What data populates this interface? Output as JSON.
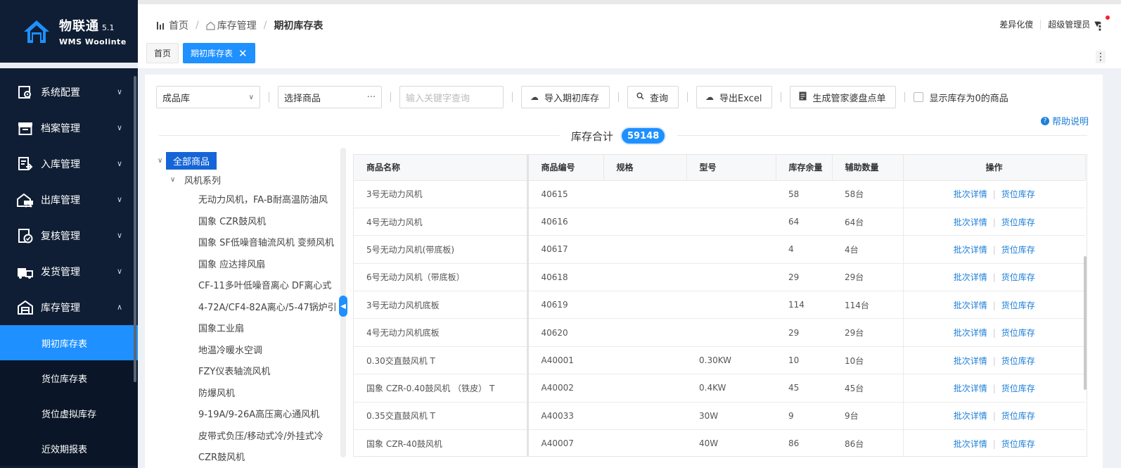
{
  "app": {
    "name": "物联通",
    "version": "5.1",
    "subtitle": "WMS Woolinte"
  },
  "sidebar": {
    "items": [
      {
        "label": "系统配置",
        "icon": "settings-box-icon",
        "arrow": "∨"
      },
      {
        "label": "档案管理",
        "icon": "archive-icon",
        "arrow": "∨"
      },
      {
        "label": "入库管理",
        "icon": "inbound-icon",
        "arrow": "∨"
      },
      {
        "label": "出库管理",
        "icon": "outbound-truck-icon",
        "arrow": "∨"
      },
      {
        "label": "复核管理",
        "icon": "review-check-icon",
        "arrow": "∨"
      },
      {
        "label": "发货管理",
        "icon": "shipping-icon",
        "arrow": "∨"
      },
      {
        "label": "库存管理",
        "icon": "warehouse-icon",
        "arrow": "∧"
      }
    ],
    "subitems": [
      {
        "label": "期初库存表",
        "active": true
      },
      {
        "label": "货位库存表",
        "active": false
      },
      {
        "label": "货位虚拟库存",
        "active": false
      },
      {
        "label": "近效期报表",
        "active": false
      }
    ]
  },
  "header": {
    "breadcrumb": [
      "首页",
      "库存管理",
      "期初库存表"
    ],
    "breadcrumb_sep": "/",
    "diff": "差异化傻",
    "user": "超级管理员",
    "tabs": [
      {
        "label": "首页",
        "active": false
      },
      {
        "label": "期初库存表",
        "active": true
      }
    ]
  },
  "toolbar": {
    "warehouse_value": "成品库",
    "product_select": "选择商品",
    "product_select_more": "···",
    "keyword_placeholder": "输入关键字查询",
    "import_label": "导入期初库存",
    "query_label": "查询",
    "export_label": "导出Excel",
    "generate_label": "生成管家婆盘点单",
    "show_zero_label": "显示库存为0的商品",
    "help_label": "帮助说明"
  },
  "summary": {
    "label": "库存合计",
    "total": "59148"
  },
  "tree": {
    "root": "全部商品",
    "group": "风机系列",
    "leaves": [
      "无动力风机，FA-B耐高温防油风",
      "国象 CZR鼓风机",
      "国象 SF低噪音轴流风机 变频风机",
      "国象 应达排风扇",
      "CF-11多叶低噪音离心 DF离心式",
      "4-72A/CF4-82A离心/5-47锅炉引",
      "国象工业扇",
      "地温冷暖水空调",
      "FZY仪表轴流风机",
      "防爆风机",
      "9-19A/9-26A高压离心通风机",
      "皮带式负压/移动式冷/外挂式冷",
      "CZR鼓风机"
    ]
  },
  "table": {
    "columns": [
      "商品名称",
      "商品编号",
      "规格",
      "型号",
      "库存余量",
      "辅助数量",
      "操作"
    ],
    "op_batch": "批次详情",
    "op_location": "货位库存",
    "rows": [
      {
        "name": "3号无动力风机",
        "code": "40615",
        "spec": "",
        "model": "",
        "qty": "58",
        "aux": "58台"
      },
      {
        "name": "4号无动力风机",
        "code": "40616",
        "spec": "",
        "model": "",
        "qty": "64",
        "aux": "64台"
      },
      {
        "name": "5号无动力风机(带底板)",
        "code": "40617",
        "spec": "",
        "model": "",
        "qty": "4",
        "aux": "4台"
      },
      {
        "name": "6号无动力风机（带底板）",
        "code": "40618",
        "spec": "",
        "model": "",
        "qty": "29",
        "aux": "29台"
      },
      {
        "name": "3号无动力风机底板",
        "code": "40619",
        "spec": "",
        "model": "",
        "qty": "114",
        "aux": "114台"
      },
      {
        "name": "4号无动力风机底板",
        "code": "40620",
        "spec": "",
        "model": "",
        "qty": "29",
        "aux": "29台"
      },
      {
        "name": "0.30交直鼓风机 T",
        "code": "A40001",
        "spec": "",
        "model": "0.30KW",
        "qty": "10",
        "aux": "10台"
      },
      {
        "name": "国象 CZR-0.40鼓风机 （铁皮） T",
        "code": "A40002",
        "spec": "",
        "model": "0.4KW",
        "qty": "45",
        "aux": "45台"
      },
      {
        "name": "0.35交直鼓风机 T",
        "code": "A40033",
        "spec": "",
        "model": "30W",
        "qty": "9",
        "aux": "9台"
      },
      {
        "name": "国象 CZR-40鼓风机",
        "code": "A40007",
        "spec": "",
        "model": "40W",
        "qty": "86",
        "aux": "86台"
      }
    ]
  },
  "colors": {
    "sidebar_bg": "#0f1e34",
    "accent": "#1e90ff",
    "link": "#1e7fd8"
  }
}
